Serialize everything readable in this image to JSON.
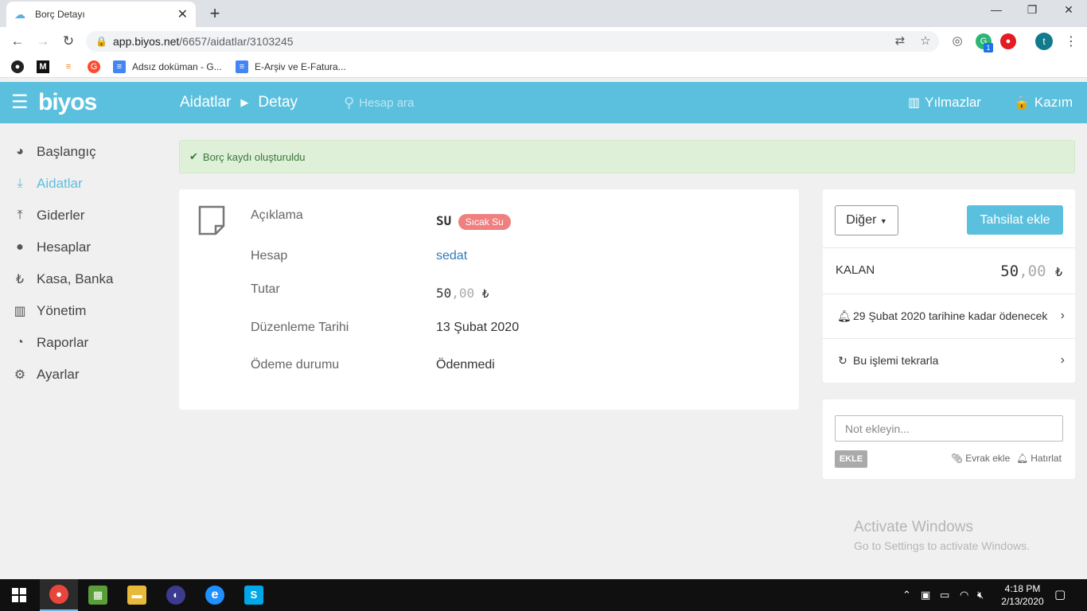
{
  "browser": {
    "tab_title": "Borç Detayı",
    "tab_close": "✕",
    "new_tab": "+",
    "url_host": "app.biyos.net",
    "url_path": "/6657/aidatlar/3103245",
    "profile_initial": "t",
    "ext_badge": "1",
    "window": {
      "minimize": "—",
      "maximize": "❐",
      "close": "✕"
    },
    "bookmarks": [
      {
        "label": "",
        "icon": "github-icon",
        "glyph": "●"
      },
      {
        "label": "",
        "icon": "medium-icon",
        "glyph": "M"
      },
      {
        "label": "",
        "icon": "stackoverflow-icon",
        "glyph": "≡"
      },
      {
        "label": "",
        "icon": "g2-icon",
        "glyph": "G"
      },
      {
        "label": "Adsız doküman - G...",
        "icon": "google-docs-icon",
        "glyph": "≡"
      },
      {
        "label": "E-Arşiv ve E-Fatura...",
        "icon": "google-docs-icon",
        "glyph": "≡"
      }
    ]
  },
  "app": {
    "logo": "biyos",
    "breadcrumb": {
      "section": "Aidatlar",
      "page": "Detay"
    },
    "search_placeholder": "Hesap ara",
    "site_name": "Yılmazlar",
    "user_name": "Kazım",
    "colors": {
      "primary": "#5bc0de",
      "badge": "#f08080",
      "success_bg": "#dff0d8",
      "link": "#337ab7"
    }
  },
  "sidebar": {
    "items": [
      {
        "label": "Başlangıç",
        "icon": "dashboard-icon",
        "active": false
      },
      {
        "label": "Aidatlar",
        "icon": "download-icon",
        "active": true
      },
      {
        "label": "Giderler",
        "icon": "upload-icon",
        "active": false
      },
      {
        "label": "Hesaplar",
        "icon": "user-icon",
        "active": false
      },
      {
        "label": "Kasa, Banka",
        "icon": "lira-icon",
        "active": false
      },
      {
        "label": "Yönetim",
        "icon": "building-icon",
        "active": false
      },
      {
        "label": "Raporlar",
        "icon": "pie-chart-icon",
        "active": false
      },
      {
        "label": "Ayarlar",
        "icon": "gear-icon",
        "active": false
      }
    ]
  },
  "alert": {
    "message": "Borç kaydı oluşturuldu"
  },
  "detail": {
    "aciklama_label": "Açıklama",
    "aciklama_value": "SU",
    "aciklama_badge": "Sıcak Su",
    "hesap_label": "Hesap",
    "hesap_value": "sedat",
    "tutar_label": "Tutar",
    "tutar_int": "50",
    "tutar_dec": ",00",
    "currency": "₺",
    "tarih_label": "Düzenleme Tarihi",
    "tarih_value": "13 Şubat 2020",
    "durum_label": "Ödeme durumu",
    "durum_value": "Ödenmedi"
  },
  "panel": {
    "diger_button": "Diğer",
    "tahsilat_button": "Tahsilat ekle",
    "kalan_label": "KALAN",
    "kalan_int": "50",
    "kalan_dec": ",00",
    "currency": "₺",
    "due_text": "29 Şubat 2020 tarihine kadar ödenecek",
    "repeat_text": "Bu işlemi tekrarla"
  },
  "note": {
    "placeholder": "Not ekleyin...",
    "add_button": "EKLE",
    "attach_label": "Evrak ekle",
    "remind_label": "Hatırlat"
  },
  "watermark": {
    "line1": "Activate Windows",
    "line2": "Go to Settings to activate Windows."
  },
  "taskbar": {
    "time": "4:18 PM",
    "date": "2/13/2020",
    "apps": [
      {
        "icon": "chrome-icon",
        "glyph": "●",
        "color": "#e8453c",
        "active": true
      },
      {
        "icon": "spreadsheet-app-icon",
        "glyph": "▦",
        "color": "#5a9e3a",
        "active": false
      },
      {
        "icon": "file-explorer-icon",
        "glyph": "▬",
        "color": "#e8b93a",
        "active": false
      },
      {
        "icon": "eclipse-icon",
        "glyph": "◐",
        "color": "#3b3b8f",
        "active": false
      },
      {
        "icon": "internet-explorer-icon",
        "glyph": "e",
        "color": "#1e90ff",
        "active": false
      },
      {
        "icon": "skype-icon",
        "glyph": "S",
        "color": "#00a8e8",
        "active": false
      }
    ]
  }
}
